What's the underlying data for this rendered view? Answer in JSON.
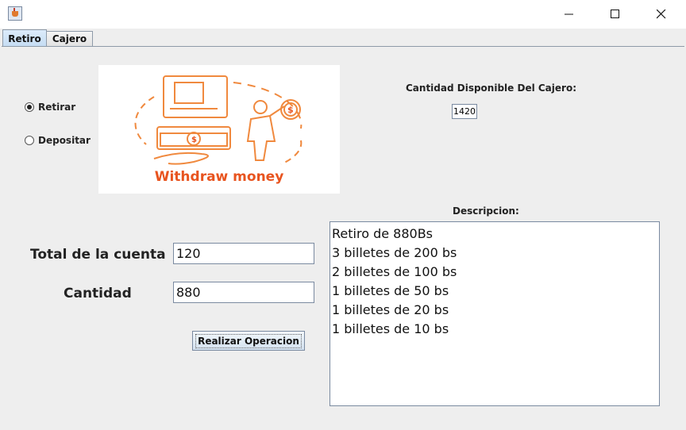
{
  "window": {
    "minimize_icon": "minimize-icon",
    "maximize_icon": "maximize-icon",
    "close_icon": "close-icon"
  },
  "tabs": [
    {
      "label": "Retiro",
      "active": true
    },
    {
      "label": "Cajero",
      "active": false
    }
  ],
  "radios": [
    {
      "label": "Retirar",
      "selected": true
    },
    {
      "label": "Depositar",
      "selected": false
    }
  ],
  "image": {
    "caption": "Withdraw money",
    "accent_color": "#e8541f",
    "line_color": "#f0893e"
  },
  "cajero": {
    "label": "Cantidad Disponible Del Cajero:",
    "value": "1420"
  },
  "form": {
    "total_label": "Total de la cuenta",
    "total_value": "120",
    "cantidad_label": "Cantidad",
    "cantidad_value": "880",
    "button_label": "Realizar Operacion"
  },
  "descripcion": {
    "label": "Descripcion:",
    "lines": [
      "Retiro de 880Bs",
      "3 billetes de 200 bs",
      "2 billetes de 100 bs",
      "1 billetes de 50 bs",
      "1 billetes de 20 bs",
      "1 billetes de 10 bs"
    ]
  }
}
